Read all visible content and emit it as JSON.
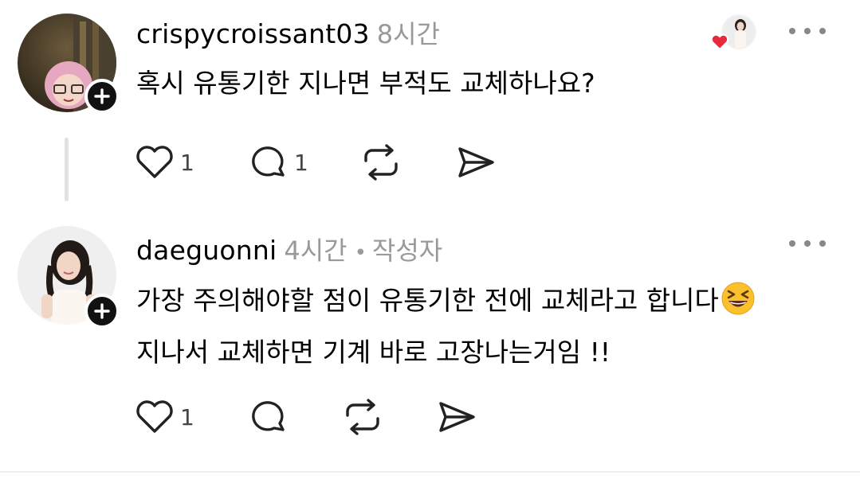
{
  "posts": [
    {
      "username": "crispycroissant03",
      "time": "8시간",
      "lines": [
        "혹시 유통기한 지나면 부적도 교체하나요?"
      ],
      "likes": "1",
      "comments": "1"
    },
    {
      "username": "daeguonni",
      "time": "4시간",
      "author_tag": "작성자",
      "dot": "•",
      "lines": [
        "가장 주의해야할 점이 유통기한 전에 교체라고 합니다",
        "지나서 교체하면 기계 바로 고장나는거임 !!"
      ],
      "likes": "1",
      "comments": ""
    }
  ],
  "icons": {
    "like": "heart-icon",
    "comment": "comment-bubble-icon",
    "repost": "repost-icon",
    "share": "send-icon",
    "more": "more-dots-icon",
    "follow": "plus-icon",
    "emoji": "grinning-squinting-face-emoji",
    "liked_by": "liked-by-avatar"
  },
  "colors": {
    "text": "#000000",
    "muted": "#999999",
    "heart_badge": "#e8283c",
    "badge_bg": "#111111"
  }
}
